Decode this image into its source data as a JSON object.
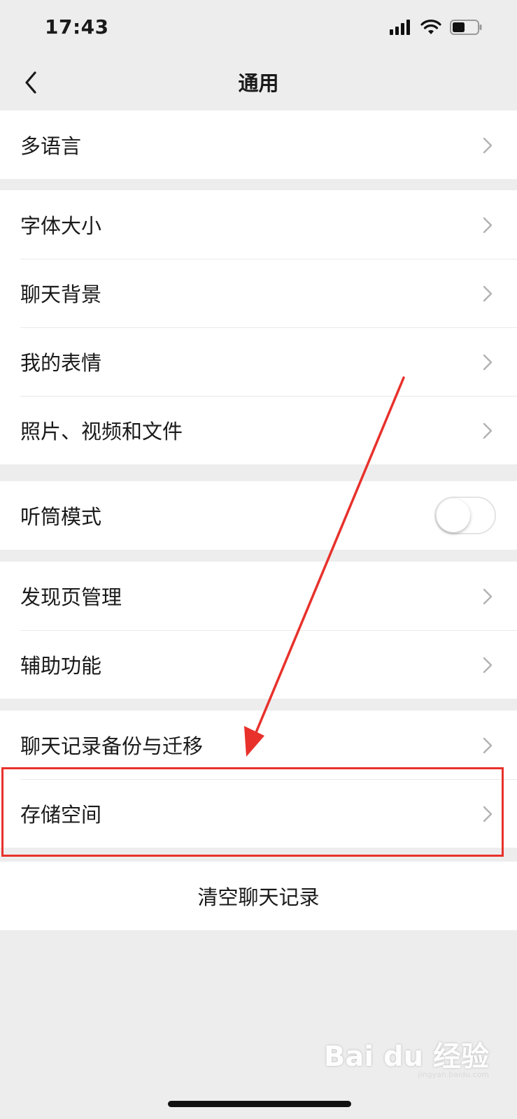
{
  "status_bar": {
    "time": "17:43"
  },
  "nav": {
    "title": "通用"
  },
  "groups": {
    "g1": {
      "language": "多语言"
    },
    "g2": {
      "font_size": "字体大小",
      "chat_background": "聊天背景",
      "my_stickers": "我的表情",
      "photos_videos_files": "照片、视频和文件"
    },
    "g3": {
      "earpiece_mode": "听筒模式",
      "earpiece_mode_on": false
    },
    "g4": {
      "discover_manage": "发现页管理",
      "accessibility": "辅助功能"
    },
    "g5": {
      "chat_backup": "聊天记录备份与迁移",
      "storage": "存储空间"
    },
    "g6": {
      "clear_history": "清空聊天记录"
    }
  },
  "annotation": {
    "color": "#e8312b",
    "highlighted_item": "存储空间"
  },
  "watermark": {
    "main": "Bai du 经验",
    "sub": "jingyan.baidu.com"
  }
}
